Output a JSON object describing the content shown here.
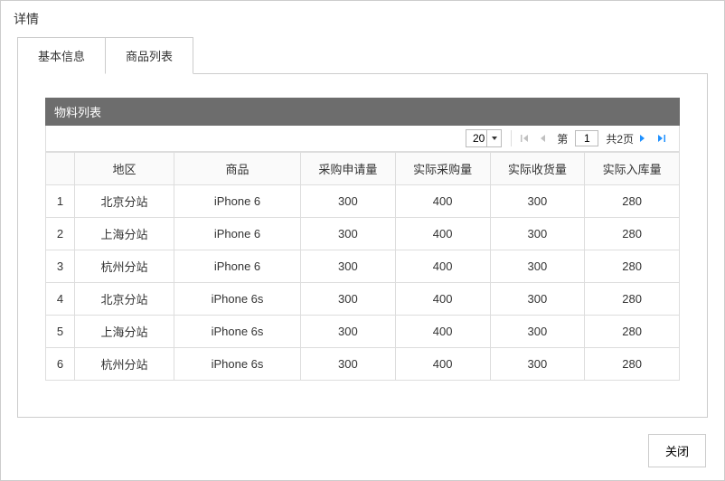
{
  "dialog": {
    "title": "详情"
  },
  "tabs": [
    {
      "label": "基本信息"
    },
    {
      "label": "商品列表"
    }
  ],
  "section": {
    "title": "物料列表"
  },
  "pager": {
    "page_size": "20",
    "page_label_prefix": "第",
    "current_page": "1",
    "total_label": "共2页"
  },
  "table": {
    "headers": [
      "",
      "地区",
      "商品",
      "采购申请量",
      "实际采购量",
      "实际收货量",
      "实际入库量"
    ],
    "rows": [
      {
        "idx": "1",
        "region": "北京分站",
        "product": "iPhone 6",
        "apply": "300",
        "purchase": "400",
        "receive": "300",
        "stock": "280"
      },
      {
        "idx": "2",
        "region": "上海分站",
        "product": "iPhone 6",
        "apply": "300",
        "purchase": "400",
        "receive": "300",
        "stock": "280"
      },
      {
        "idx": "3",
        "region": "杭州分站",
        "product": "iPhone 6",
        "apply": "300",
        "purchase": "400",
        "receive": "300",
        "stock": "280"
      },
      {
        "idx": "4",
        "region": "北京分站",
        "product": "iPhone 6s",
        "apply": "300",
        "purchase": "400",
        "receive": "300",
        "stock": "280"
      },
      {
        "idx": "5",
        "region": "上海分站",
        "product": "iPhone 6s",
        "apply": "300",
        "purchase": "400",
        "receive": "300",
        "stock": "280"
      },
      {
        "idx": "6",
        "region": "杭州分站",
        "product": "iPhone 6s",
        "apply": "300",
        "purchase": "400",
        "receive": "300",
        "stock": "280"
      }
    ]
  },
  "footer": {
    "close_label": "关闭"
  }
}
